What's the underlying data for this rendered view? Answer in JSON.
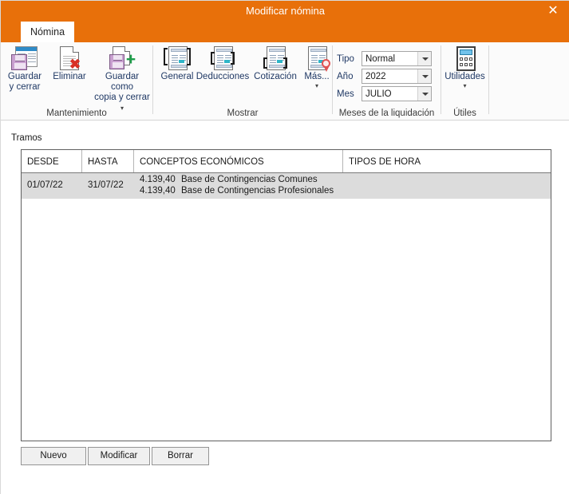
{
  "window": {
    "title": "Modificar nómina",
    "close_icon": "close-icon",
    "accent_color": "#e8700a"
  },
  "tabs": [
    {
      "label": "Nómina",
      "active": true
    }
  ],
  "ribbon": {
    "groups": [
      {
        "label": "Mantenimiento",
        "buttons": [
          {
            "name": "guardar-y-cerrar",
            "label_line1": "Guardar",
            "label_line2": "y cerrar",
            "icon": "grid-save-icon",
            "caret": false
          },
          {
            "name": "eliminar",
            "label_line1": "Eliminar",
            "label_line2": "",
            "icon": "page-delete-icon",
            "caret": false
          },
          {
            "name": "guardar-como-copia-y-cerrar",
            "label_line1": "Guardar como",
            "label_line2": "copia y cerrar",
            "icon": "page-save-copy-icon",
            "caret": true,
            "caret_inline": true
          }
        ]
      },
      {
        "label": "Mostrar",
        "buttons": [
          {
            "name": "general",
            "label_line1": "General",
            "label_line2": "",
            "icon": "form-top-icon",
            "caret": false
          },
          {
            "name": "deducciones",
            "label_line1": "Deducciones",
            "label_line2": "",
            "icon": "form-mid-icon",
            "caret": false
          },
          {
            "name": "cotizacion",
            "label_line1": "Cotización",
            "label_line2": "",
            "icon": "form-low-icon",
            "caret": false
          },
          {
            "name": "mas",
            "label_line1": "Más...",
            "label_line2": "",
            "icon": "form-seal-icon",
            "caret": true
          }
        ]
      },
      {
        "label": "Meses de la liquidación",
        "fields": [
          {
            "name": "tipo",
            "label": "Tipo",
            "value": "Normal"
          },
          {
            "name": "ano",
            "label": "Año",
            "value": "2022"
          },
          {
            "name": "mes",
            "label": "Mes",
            "value": "JULIO"
          }
        ]
      },
      {
        "label": "Útiles",
        "buttons": [
          {
            "name": "utilidades",
            "label_line1": "Utilidades",
            "label_line2": "",
            "icon": "calculator-icon",
            "caret": true
          }
        ]
      }
    ]
  },
  "main": {
    "section_label": "Tramos",
    "table": {
      "columns": [
        "DESDE",
        "HASTA",
        "CONCEPTOS ECONÓMICOS",
        "TIPOS DE HORA"
      ],
      "rows": [
        {
          "selected": true,
          "desde": "01/07/22",
          "hasta": "31/07/22",
          "conceptos": [
            {
              "amount": "4.139,40",
              "description": "Base de Contingencias Comunes"
            },
            {
              "amount": "4.139,40",
              "description": "Base de Contingencias Profesionales"
            }
          ],
          "tipos_de_hora": ""
        }
      ],
      "selected_row_color": "#dcdcdc"
    },
    "buttons": [
      {
        "name": "nuevo",
        "label": "Nuevo"
      },
      {
        "name": "modificar",
        "label": "Modificar"
      },
      {
        "name": "borrar",
        "label": "Borrar"
      }
    ]
  }
}
